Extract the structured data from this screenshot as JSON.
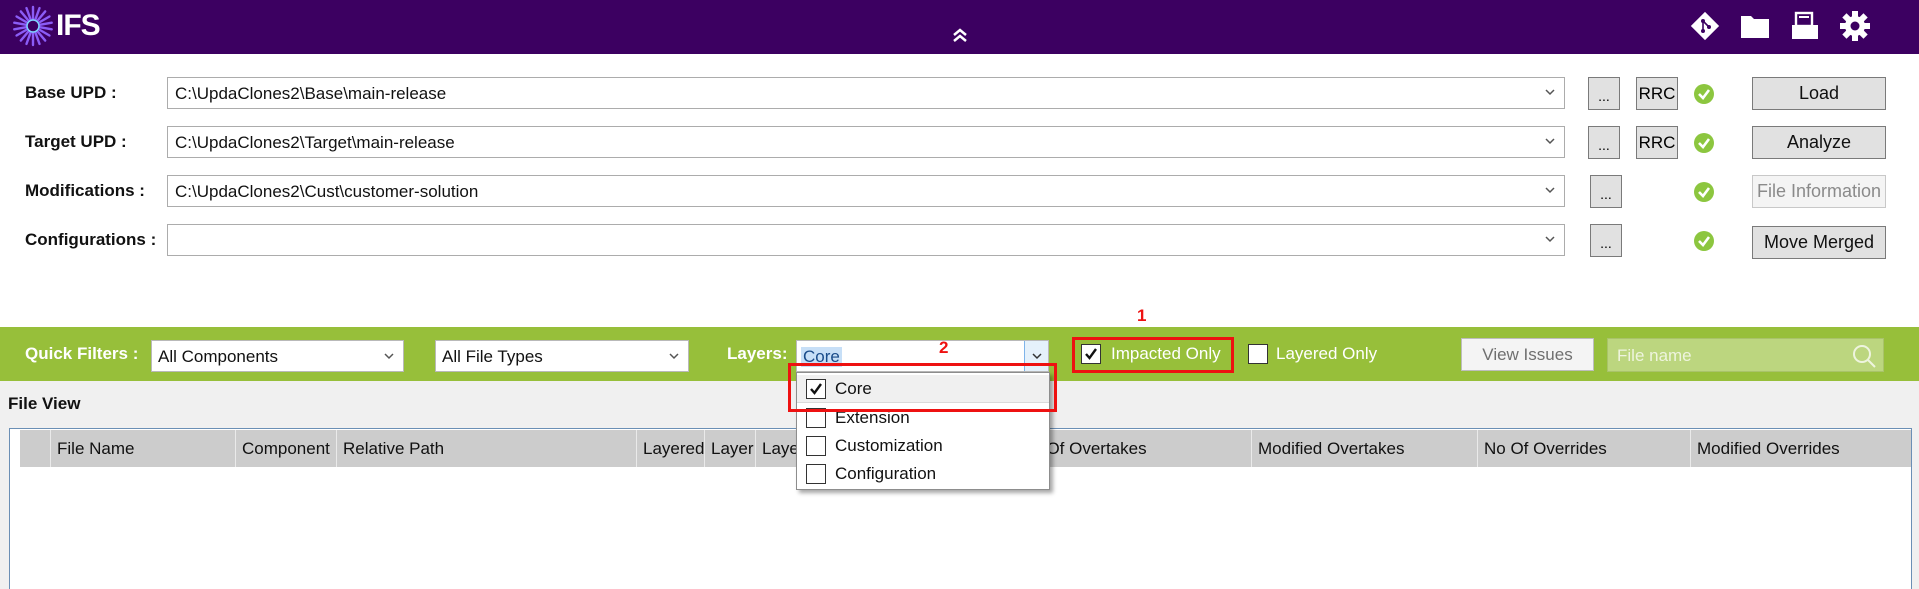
{
  "header": {
    "logo_text": "IFS",
    "icons": [
      "git-icon",
      "folder-icon",
      "printer-icon",
      "gear-icon"
    ],
    "collapse_icon": "double-chevron-up-icon",
    "colors": {
      "header_bg": "#3c0061",
      "accent_green": "#97bf3a",
      "ok_green": "#8cc63f",
      "annotation_red": "#ee1111"
    }
  },
  "form": {
    "rows": [
      {
        "label": "Base UPD :",
        "value": "C:\\UpdaClones2\\Base\\main-release",
        "browse": "...",
        "rrc": "RRC",
        "status": "ok",
        "action": "Load",
        "action_enabled": true
      },
      {
        "label": "Target UPD :",
        "value": "C:\\UpdaClones2\\Target\\main-release",
        "browse": "...",
        "rrc": "RRC",
        "status": "ok",
        "action": "Analyze",
        "action_enabled": true
      },
      {
        "label": "Modifications :",
        "value": "C:\\UpdaClones2\\Cust\\customer-solution",
        "browse": "...",
        "status": "ok",
        "action": "File Information",
        "action_enabled": false
      },
      {
        "label": "Configurations :",
        "value": "",
        "browse": "...",
        "status": "ok",
        "action": "Move Merged",
        "action_enabled": true
      }
    ]
  },
  "filters": {
    "quick_filters_label": "Quick Filters :",
    "components_value": "All Components",
    "file_types_value": "All File Types",
    "layers_label": "Layers:",
    "layers_value": "Core",
    "impacted_only": {
      "label": "Impacted Only",
      "checked": true
    },
    "layered_only": {
      "label": "Layered Only",
      "checked": false
    },
    "view_issues": "View Issues",
    "search_placeholder": "File name"
  },
  "layers_dropdown": {
    "items": [
      {
        "label": "Core",
        "checked": true
      },
      {
        "label": "Extension",
        "checked": false
      },
      {
        "label": "Customization",
        "checked": false
      },
      {
        "label": "Configuration",
        "checked": false
      }
    ]
  },
  "annotations": {
    "one": "1",
    "two": "2"
  },
  "file_view": {
    "title": "File View",
    "columns": [
      "File Name",
      "Component",
      "Relative Path",
      "Layered",
      "Layer",
      "Layer",
      "No Of Overtakes",
      "Modified Overtakes",
      "No Of Overrides",
      "Modified Overrides"
    ],
    "rows": []
  }
}
